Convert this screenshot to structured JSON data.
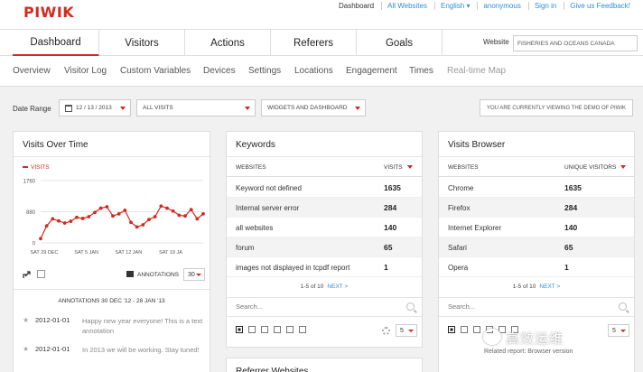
{
  "header": {
    "logo": "PIWIK",
    "links": [
      "Dashboard",
      "All Websites",
      "English ▾",
      "anonymous",
      "Sign in",
      "Give us Feedback!"
    ]
  },
  "mainnav": {
    "tabs": [
      "Dashboard",
      "Visitors",
      "Actions",
      "Referers",
      "Goals"
    ],
    "active": "Dashboard",
    "website_label": "Website",
    "website_value": "FISHERIES AND OCEANS CANADA"
  },
  "subnav": {
    "items": [
      "Overview",
      "Visitor Log",
      "Custom Variables",
      "Devices",
      "Settings",
      "Locations",
      "Engagement",
      "Times",
      "Real-time Map"
    ]
  },
  "controls": {
    "date_label": "Date Range",
    "date_value": "12 / 13 / 2013",
    "segment": "ALL VISITS",
    "dashboard_menu": "WIDGETS AND DASHBOARD",
    "demo_note": "YOU ARE CURRENTLY VIEWING THE DEMO OF PIWIK"
  },
  "visits_over_time": {
    "title": "Visits Over Time",
    "legend": "VISITS",
    "annotations_label": "ANNOTATIONS",
    "period_limit": "30",
    "annotations_header": "ANNOTATIONS 30 DEC '12 - 28 JAN '13",
    "annotations": [
      {
        "date": "2012-01-01",
        "note": "Happy new year everyone! This is a text annotation"
      },
      {
        "date": "2012-01-01",
        "note": "In 2013 we will be working. Stay tuned!"
      }
    ]
  },
  "chart_data": {
    "type": "line",
    "series": [
      {
        "name": "VISITS",
        "values": [
          120,
          480,
          680,
          620,
          560,
          610,
          720,
          690,
          740,
          860,
          980,
          1020,
          760,
          820,
          920,
          580,
          450,
          510,
          660,
          740,
          1040,
          980,
          900,
          780,
          760,
          940,
          680,
          820
        ]
      }
    ],
    "x_tick_labels": [
      "SAT 29 DEC",
      "SAT 5 JAN",
      "SAT 12 JAN",
      "SAT 19 JA"
    ],
    "y_tick_labels": [
      "0",
      "880",
      "1760"
    ],
    "ylim": [
      0,
      1760
    ],
    "grid": true
  },
  "keywords": {
    "title": "Keywords",
    "col1": "WEBSITES",
    "col2": "VISITS",
    "rows": [
      {
        "label": "Keyword not defined",
        "value": "1635"
      },
      {
        "label": "Internal server error",
        "value": "284"
      },
      {
        "label": "all websites",
        "value": "140"
      },
      {
        "label": "forum",
        "value": "65"
      },
      {
        "label": "images not displayed in tcpdf report",
        "value": "1"
      }
    ],
    "pager": "1-5 of 10",
    "next": "NEXT >",
    "search_placeholder": "Search...",
    "limit": "5"
  },
  "browsers": {
    "title": "Visits Browser",
    "col1": "WEBSITES",
    "col2": "UNIQUE VISITORS",
    "rows": [
      {
        "label": "Chrome",
        "value": "1635"
      },
      {
        "label": "Firefox",
        "value": "284"
      },
      {
        "label": "Internet Explorer",
        "value": "140"
      },
      {
        "label": "Safari",
        "value": "65"
      },
      {
        "label": "Opera",
        "value": "1"
      }
    ],
    "pager": "1-5 of 10",
    "next": "NEXT >",
    "search_placeholder": "Search...",
    "limit": "5",
    "related": "Related report: Browser version"
  },
  "referrer": {
    "title": "Referrer Websites"
  },
  "watermark": {
    "text": "高效运维"
  },
  "colors": {
    "accent": "#d4291f",
    "link": "#2f8fd8"
  }
}
